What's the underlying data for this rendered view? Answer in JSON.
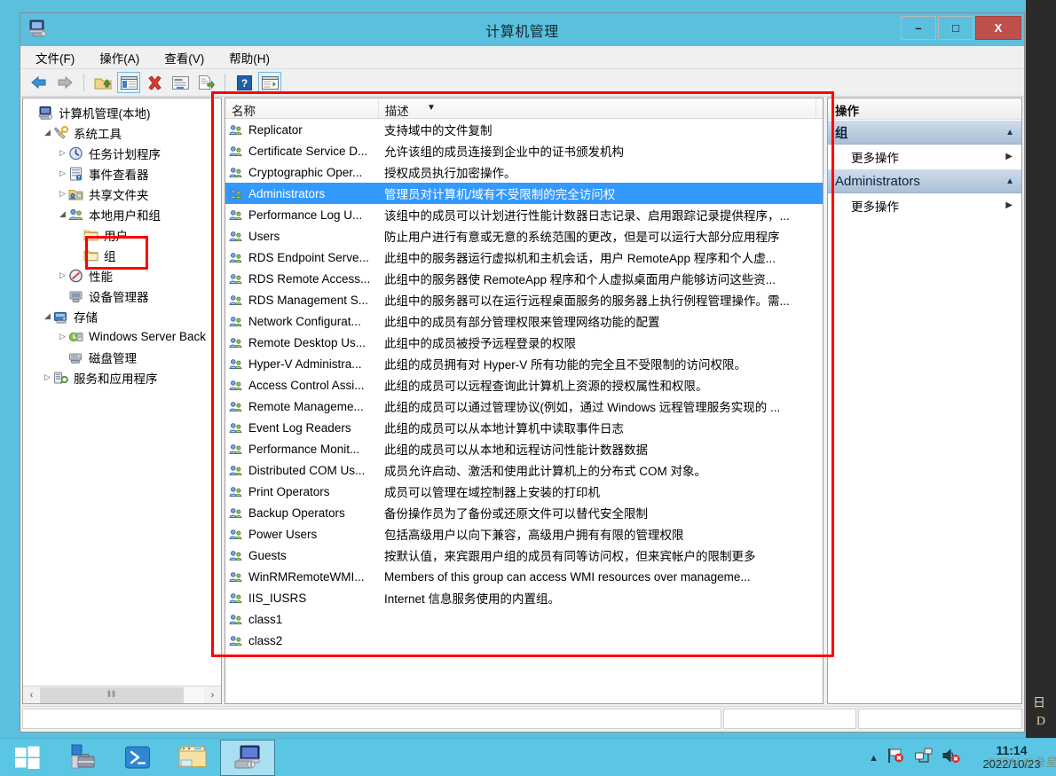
{
  "window": {
    "title": "计算机管理",
    "app_icon": "computer-management-icon",
    "buttons": {
      "minimize": "–",
      "maximize": "□",
      "close": "X"
    }
  },
  "menubar": {
    "items": [
      {
        "label": "文件(F)",
        "name": "menu-file"
      },
      {
        "label": "操作(A)",
        "name": "menu-action"
      },
      {
        "label": "查看(V)",
        "name": "menu-view"
      },
      {
        "label": "帮助(H)",
        "name": "menu-help"
      }
    ]
  },
  "toolbar": {
    "items": [
      {
        "name": "back-icon",
        "glyph": "⬅"
      },
      {
        "name": "forward-icon",
        "glyph": "➡"
      },
      {
        "name": "up-folder-icon",
        "glyph": "⤴"
      },
      {
        "name": "show-hide-console-tree-icon",
        "glyph": "▤"
      },
      {
        "name": "delete-icon",
        "glyph": "✕"
      },
      {
        "name": "properties-icon",
        "glyph": "▣"
      },
      {
        "name": "export-list-icon",
        "glyph": "≡"
      },
      {
        "name": "help-icon",
        "glyph": "?"
      },
      {
        "name": "show-hide-action-pane-icon",
        "glyph": "▶"
      }
    ]
  },
  "tree": {
    "nodes": [
      {
        "label": "计算机管理(本地)",
        "indent": 0,
        "expander": "",
        "icon": "computer-icon",
        "name": "tree-computer-management-local"
      },
      {
        "label": "系统工具",
        "indent": 1,
        "expander": "◢",
        "icon": "system-tools-icon",
        "name": "tree-system-tools"
      },
      {
        "label": "任务计划程序",
        "indent": 2,
        "expander": "▷",
        "icon": "task-scheduler-icon",
        "name": "tree-task-scheduler"
      },
      {
        "label": "事件查看器",
        "indent": 2,
        "expander": "▷",
        "icon": "event-viewer-icon",
        "name": "tree-event-viewer"
      },
      {
        "label": "共享文件夹",
        "indent": 2,
        "expander": "▷",
        "icon": "shared-folders-icon",
        "name": "tree-shared-folders"
      },
      {
        "label": "本地用户和组",
        "indent": 2,
        "expander": "◢",
        "icon": "local-users-groups-icon",
        "name": "tree-local-users-and-groups"
      },
      {
        "label": "用户",
        "indent": 3,
        "expander": "",
        "icon": "folder-icon",
        "name": "tree-users"
      },
      {
        "label": "组",
        "indent": 3,
        "expander": "",
        "icon": "folder-icon",
        "name": "tree-groups",
        "selected": true
      },
      {
        "label": "性能",
        "indent": 2,
        "expander": "▷",
        "icon": "performance-icon",
        "name": "tree-performance"
      },
      {
        "label": "设备管理器",
        "indent": 2,
        "expander": "",
        "icon": "device-manager-icon",
        "name": "tree-device-manager"
      },
      {
        "label": "存储",
        "indent": 1,
        "expander": "◢",
        "icon": "storage-icon",
        "name": "tree-storage"
      },
      {
        "label": "Windows Server Back",
        "indent": 2,
        "expander": "▷",
        "icon": "windows-server-backup-icon",
        "name": "tree-windows-server-backup"
      },
      {
        "label": "磁盘管理",
        "indent": 2,
        "expander": "",
        "icon": "disk-management-icon",
        "name": "tree-disk-management"
      },
      {
        "label": "服务和应用程序",
        "indent": 1,
        "expander": "▷",
        "icon": "services-applications-icon",
        "name": "tree-services-and-applications"
      }
    ],
    "hscrollbar": {
      "left_glyph": "‹",
      "right_glyph": "›",
      "thumb_glyph": "‖‖"
    }
  },
  "list": {
    "columns": [
      {
        "label": "名称",
        "name": "column-name"
      },
      {
        "label": "描述",
        "name": "column-description"
      },
      {
        "label": "",
        "name": "column-spacer"
      }
    ],
    "sort_indicator": "▼",
    "rows": [
      {
        "name": "Replicator",
        "desc": "支持域中的文件复制"
      },
      {
        "name": "Certificate Service D...",
        "desc": "允许该组的成员连接到企业中的证书颁发机构"
      },
      {
        "name": "Cryptographic Oper...",
        "desc": "授权成员执行加密操作。"
      },
      {
        "name": "Administrators",
        "desc": "管理员对计算机/域有不受限制的完全访问权",
        "selected": true
      },
      {
        "name": "Performance Log U...",
        "desc": "该组中的成员可以计划进行性能计数器日志记录、启用跟踪记录提供程序，..."
      },
      {
        "name": "Users",
        "desc": "防止用户进行有意或无意的系统范围的更改，但是可以运行大部分应用程序"
      },
      {
        "name": "RDS Endpoint Serve...",
        "desc": "此组中的服务器运行虚拟机和主机会话，用户 RemoteApp 程序和个人虚..."
      },
      {
        "name": "RDS Remote Access...",
        "desc": "此组中的服务器使 RemoteApp 程序和个人虚拟桌面用户能够访问这些资..."
      },
      {
        "name": "RDS Management S...",
        "desc": "此组中的服务器可以在运行远程桌面服务的服务器上执行例程管理操作。需..."
      },
      {
        "name": "Network Configurat...",
        "desc": "此组中的成员有部分管理权限来管理网络功能的配置"
      },
      {
        "name": "Remote Desktop Us...",
        "desc": "此组中的成员被授予远程登录的权限"
      },
      {
        "name": "Hyper-V Administra...",
        "desc": "此组的成员拥有对 Hyper-V 所有功能的完全且不受限制的访问权限。"
      },
      {
        "name": "Access Control Assi...",
        "desc": "此组的成员可以远程查询此计算机上资源的授权属性和权限。"
      },
      {
        "name": "Remote Manageme...",
        "desc": "此组的成员可以通过管理协议(例如，通过 Windows 远程管理服务实现的 ..."
      },
      {
        "name": "Event Log Readers",
        "desc": "此组的成员可以从本地计算机中读取事件日志"
      },
      {
        "name": "Performance Monit...",
        "desc": "此组的成员可以从本地和远程访问性能计数器数据"
      },
      {
        "name": "Distributed COM Us...",
        "desc": "成员允许启动、激活和使用此计算机上的分布式 COM 对象。"
      },
      {
        "name": "Print Operators",
        "desc": "成员可以管理在域控制器上安装的打印机"
      },
      {
        "name": "Backup Operators",
        "desc": "备份操作员为了备份或还原文件可以替代安全限制"
      },
      {
        "name": "Power Users",
        "desc": "包括高级用户以向下兼容，高级用户拥有有限的管理权限"
      },
      {
        "name": "Guests",
        "desc": "按默认值，来宾跟用户组的成员有同等访问权，但来宾帐户的限制更多"
      },
      {
        "name": "WinRMRemoteWMI...",
        "desc": "Members of this group can access WMI resources over manageme..."
      },
      {
        "name": "IIS_IUSRS",
        "desc": "Internet 信息服务使用的内置组。"
      },
      {
        "name": "class1",
        "desc": ""
      },
      {
        "name": "class2",
        "desc": ""
      }
    ]
  },
  "actions": {
    "title": "操作",
    "groups": [
      {
        "label": "组",
        "name": "actions-group-groups",
        "chevron": "▲",
        "items": [
          {
            "label": "更多操作",
            "arrow": "▶",
            "name": "actions-more-actions-groups"
          }
        ]
      },
      {
        "label": "Administrators",
        "name": "actions-group-administrators",
        "chevron": "▲",
        "items": [
          {
            "label": "更多操作",
            "arrow": "▶",
            "name": "actions-more-actions-administrators"
          }
        ]
      }
    ]
  },
  "taskbar": {
    "items": [
      {
        "name": "start-button",
        "icon": "windows-logo-icon"
      },
      {
        "name": "taskbar-server-manager",
        "icon": "server-manager-icon"
      },
      {
        "name": "taskbar-powershell",
        "icon": "powershell-icon"
      },
      {
        "name": "taskbar-file-explorer",
        "icon": "file-explorer-icon"
      },
      {
        "name": "taskbar-computer-management",
        "icon": "computer-management-icon",
        "active": true
      }
    ],
    "tray": {
      "overflow_arrow": "▲",
      "icons": [
        {
          "name": "network-flag-alert-icon"
        },
        {
          "name": "network-connection-icon"
        },
        {
          "name": "volume-muted-icon"
        }
      ],
      "clock": {
        "time": "11:14",
        "date": "2022/10/23"
      },
      "watermark": "CSDN @录星"
    }
  },
  "edge_fragments": [
    "日",
    "D"
  ],
  "colors": {
    "accent": "#5bc0de",
    "selection": "#3399ff",
    "annotation": "#ff0000",
    "close_button": "#c0504d",
    "actions_group": "#a9c0d8"
  }
}
